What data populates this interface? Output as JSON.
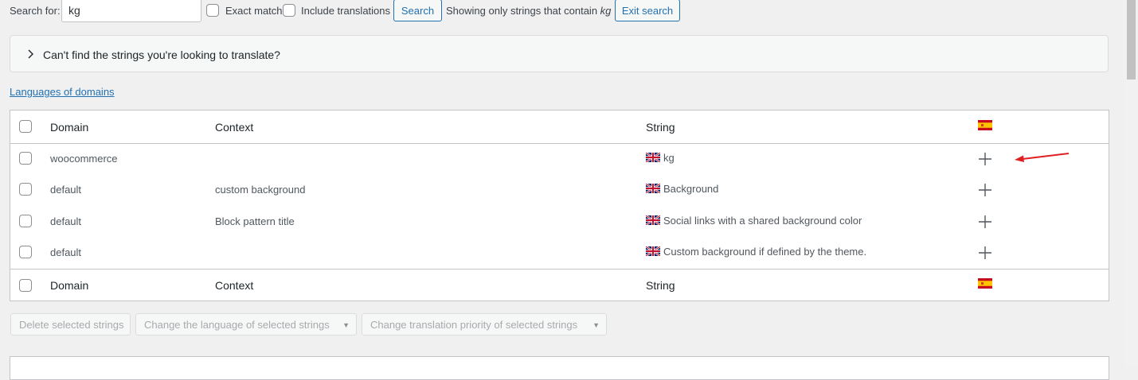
{
  "search": {
    "label": "Search for:",
    "value": "kg",
    "exact_match_label": "Exact match",
    "include_translations_label": "Include translations",
    "button_label": "Search",
    "status_prefix": "Showing only strings that contain ",
    "status_term": "kg",
    "exit_label": "Exit search"
  },
  "notice": {
    "text": "Can't find the strings you're looking to translate?"
  },
  "languages_link": "Languages of domains",
  "table": {
    "headers": {
      "domain": "Domain",
      "context": "Context",
      "string": "String"
    },
    "language_flag": "spain-flag-icon",
    "rows": [
      {
        "domain": "woocommerce",
        "context": "",
        "string": "kg"
      },
      {
        "domain": "default",
        "context": "custom background",
        "string": "Background"
      },
      {
        "domain": "default",
        "context": "Block pattern title",
        "string": "Social links with a shared background color"
      },
      {
        "domain": "default",
        "context": "",
        "string": "Custom background if defined by the theme."
      }
    ]
  },
  "bulk_actions": {
    "delete_label": "Delete selected strings",
    "change_language_label": "Change the language of selected strings",
    "change_priority_label": "Change translation priority of selected strings"
  },
  "colors": {
    "link": "#2271b1",
    "annotation_arrow": "#e02020",
    "plus_icon": "#50575e"
  }
}
